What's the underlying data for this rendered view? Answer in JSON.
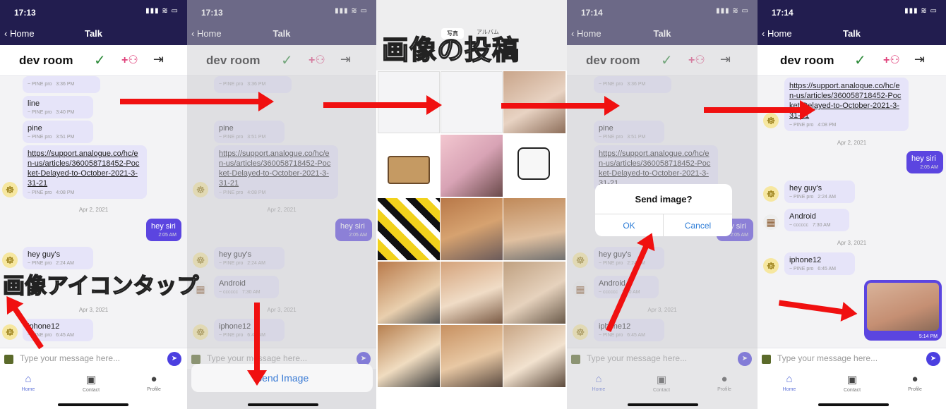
{
  "status": {
    "time1": "17:13",
    "time2": "17:13",
    "time4": "17:14",
    "time5": "17:14",
    "icons": "▮▮▮ ≋ ▭"
  },
  "nav": {
    "back": "‹ Home",
    "title": "Talk"
  },
  "room": {
    "name": "dev room"
  },
  "msgs": {
    "pine_meta": "~ PINE pro",
    "t1": "3:36 PM",
    "line": "line",
    "t2": "3:40 PM",
    "pine": "pine",
    "t3": "3:51 PM",
    "link": "https://support.analogue.co/hc/en-us/articles/360058718452-Pocket-Delayed-to-October-2021-3-31-21",
    "t4": "4:08 PM",
    "date1": "Apr 2, 2021",
    "heysiri": "hey siri",
    "t5": "2:05 AM",
    "heyguys": "hey guy's",
    "t6": "2:24 AM",
    "android": "Android",
    "cc_meta": "~ cccccc",
    "t7": "7:30 AM",
    "date2": "Apr 3, 2021",
    "iphone": "iphone12",
    "t8": "6:45 AM",
    "t9": "5:14 PM"
  },
  "input": {
    "placeholder": "Type your message here..."
  },
  "tabs": {
    "home": "Home",
    "contact": "Contact",
    "profile": "Profile"
  },
  "sheet": {
    "send_image": "Send Image"
  },
  "alert": {
    "question": "Send image?",
    "ok": "OK",
    "cancel": "Cancel"
  },
  "captions": {
    "tap_icon": "画像アイコンタップ",
    "post_image": "画像の投稿"
  },
  "picker": {
    "tab1": "写真",
    "tab2": "アルバム"
  },
  "colors": {
    "nav": "#221d4f",
    "accent": "#5b45e0",
    "arrow": "#f01010"
  }
}
